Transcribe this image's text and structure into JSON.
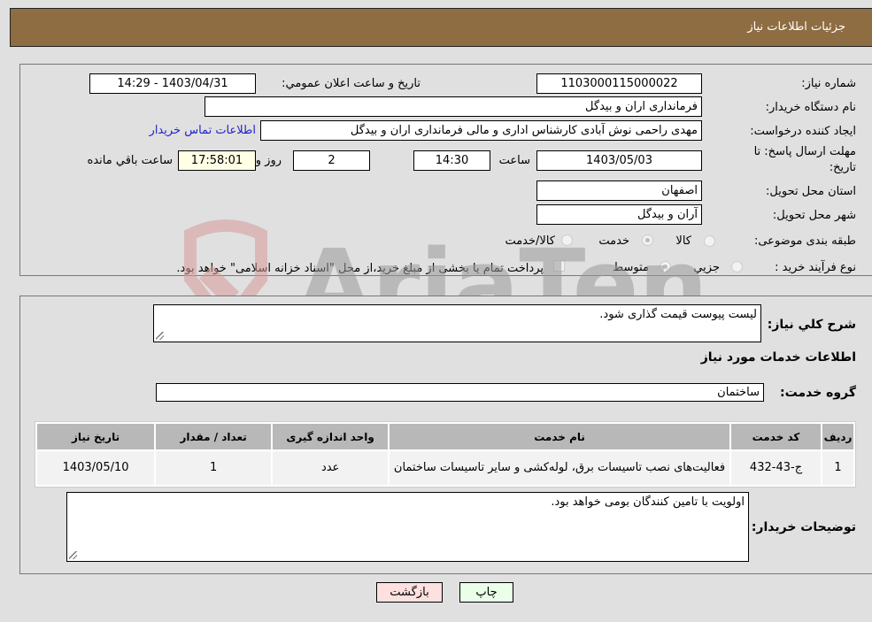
{
  "header": {
    "title": "جزئیات اطلاعات نیاز"
  },
  "details": {
    "need_number_label": "شماره نیاز:",
    "need_number": "1103000115000022",
    "announce_label": "تاریخ و ساعت اعلان عمومي:",
    "announce_value": "1403/04/31 - 14:29",
    "buyer_org_label": "نام دستگاه خریدار:",
    "buyer_org": "فرمانداری اران و بیدگل",
    "creator_label": "ایجاد کننده درخواست:",
    "creator": "مهدی راحمی نوش آبادی کارشناس اداری و مالی  فرمانداری اران و بیدگل",
    "contact_link": "اطلاعات تماس خریدار",
    "deadline_label_1": "مهلت ارسال پاسخ: تا",
    "deadline_label_2": "تاریخ:",
    "deadline_date": "1403/05/03",
    "time_label": "ساعت",
    "deadline_time": "14:30",
    "days_value": "2",
    "days_label": "روز و",
    "remaining_time": "17:58:01",
    "remaining_label": "ساعت باقي مانده",
    "province_label": "استان محل تحویل:",
    "province": "اصفهان",
    "city_label": "شهر محل تحویل:",
    "city": "آران و بیدگل",
    "category_label": "طبقه بندی موضوعی:",
    "category_options": [
      "کالا",
      "خدمت",
      "کالا/خدمت"
    ],
    "category_selected": "خدمت",
    "process_label": "نوع فرآیند خرید :",
    "process_options": [
      "جزيي",
      "متوسط"
    ],
    "process_selected": "متوسط",
    "treasury_note": "پرداخت تمام یا بخشی از مبلغ خرید،از محل \"اسناد خزانه اسلامی\" خواهد بود."
  },
  "needs": {
    "description_label": "شرح کلي نیاز:",
    "description": "لیست پیوست قیمت گذاری شود.",
    "services_heading": "اطلاعات خدمات مورد نیاز",
    "service_group_label": "گروه خدمت:",
    "service_group": "ساختمان",
    "table": {
      "headers": [
        "ردیف",
        "کد خدمت",
        "نام خدمت",
        "واحد اندازه گیری",
        "تعداد / مقدار",
        "تاریخ نیاز"
      ],
      "rows": [
        [
          "1",
          "ج-43-432",
          "فعالیت‌های نصب تاسیسات برق، لوله‌کشی و سایر تاسیسات ساختمان",
          "عدد",
          "1",
          "1403/05/10"
        ]
      ]
    },
    "buyer_notes_label": "توضیحات خریدار:",
    "buyer_notes": "اولویت با تامین کنندگان بومی خواهد بود."
  },
  "buttons": {
    "print": "چاپ",
    "back": "بازگشت"
  },
  "watermark": {
    "text": "AriaTender.neT"
  }
}
